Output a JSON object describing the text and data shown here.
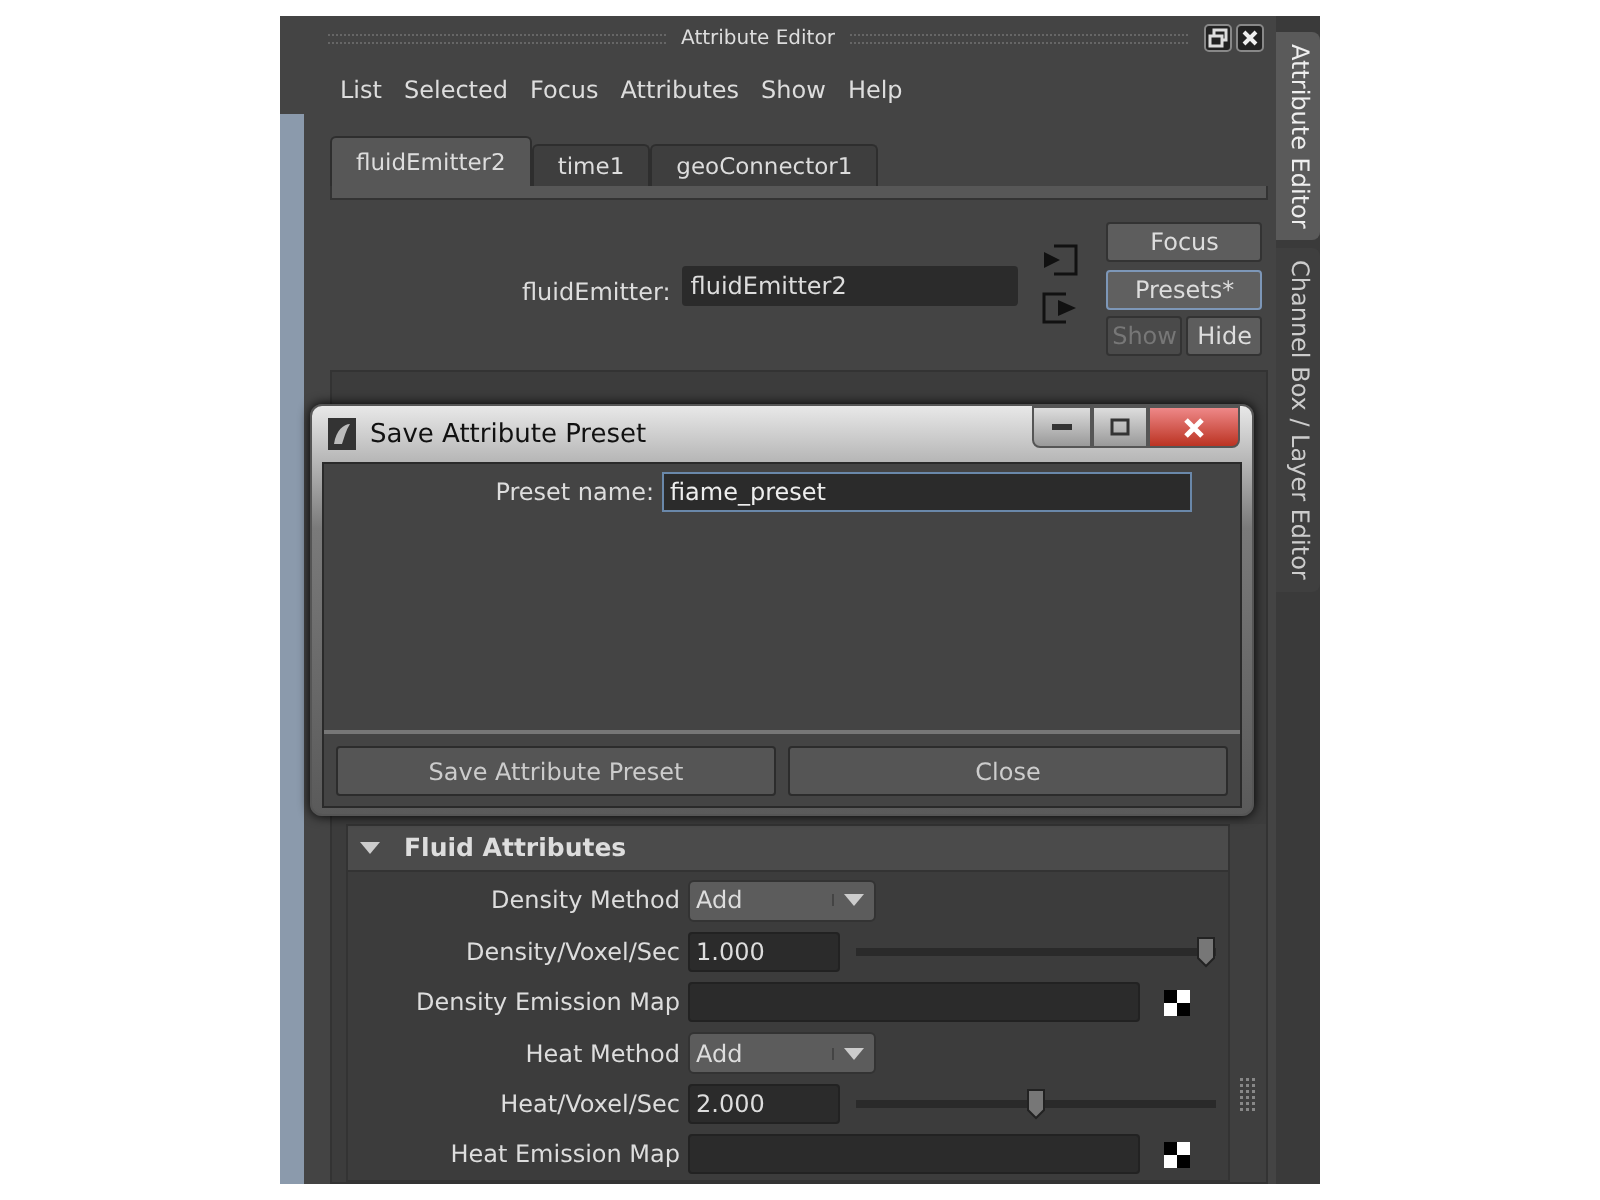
{
  "window": {
    "title": "Attribute Editor"
  },
  "side_tabs": [
    {
      "label": "Attribute Editor",
      "selected": true
    },
    {
      "label": "Channel Box / Layer Editor",
      "selected": false
    }
  ],
  "menu": [
    "List",
    "Selected",
    "Focus",
    "Attributes",
    "Show",
    "Help"
  ],
  "tabs": [
    {
      "label": "fluidEmitter2",
      "selected": true
    },
    {
      "label": "time1",
      "selected": false
    },
    {
      "label": "geoConnector1",
      "selected": false
    }
  ],
  "node": {
    "label": "fluidEmitter:",
    "value": "fluidEmitter2"
  },
  "buttons": [
    {
      "label": "Focus",
      "disabled": false,
      "focused": false
    },
    {
      "label": "Presets*",
      "disabled": false,
      "focused": true
    },
    {
      "label": "Show",
      "disabled": true,
      "focused": false
    },
    {
      "label": "Hide",
      "disabled": false,
      "focused": false
    }
  ],
  "section": {
    "title": "Fluid Attributes",
    "expanded": true,
    "rows": [
      {
        "kind": "dropdown",
        "label": "Density Method",
        "value": "Add"
      },
      {
        "kind": "slider",
        "label": "Density/Voxel/Sec",
        "value": "1.000",
        "level": 0.97
      },
      {
        "kind": "map",
        "label": "Density Emission Map"
      },
      {
        "kind": "dropdown",
        "label": "Heat Method",
        "value": "Add"
      },
      {
        "kind": "slider",
        "label": "Heat/Voxel/Sec",
        "value": "2.000",
        "level": 0.5
      },
      {
        "kind": "map",
        "label": "Heat Emission Map"
      }
    ]
  },
  "dialog": {
    "title": "Save Attribute Preset",
    "field_label": "Preset name:",
    "value": "fiame_preset",
    "buttons": [
      "Save Attribute Preset",
      "Close"
    ]
  }
}
